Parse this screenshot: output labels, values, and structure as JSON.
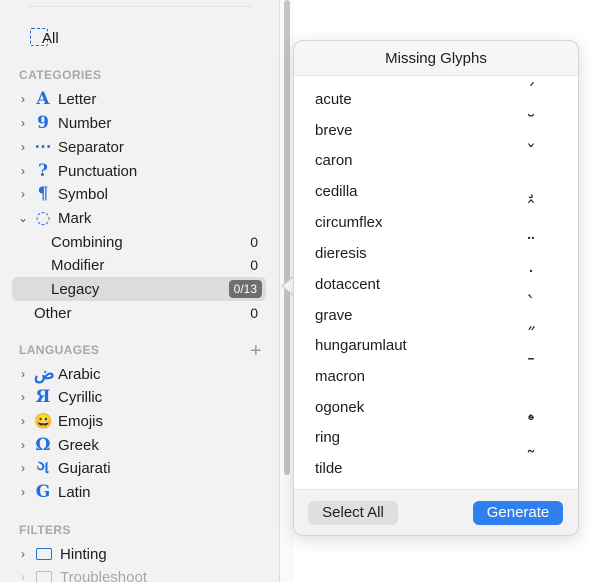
{
  "sidebar": {
    "all_label": "All",
    "categories_header": "CATEGORIES",
    "categories": [
      {
        "icon": "A",
        "label": "Letter"
      },
      {
        "icon": "9",
        "label": "Number"
      },
      {
        "icon": "⋯",
        "label": "Separator"
      },
      {
        "icon": "?",
        "label": "Punctuation"
      },
      {
        "icon": "¶",
        "label": "Symbol"
      },
      {
        "icon": "◌",
        "label": "Mark"
      }
    ],
    "mark_children": [
      {
        "label": "Combining",
        "count": "0"
      },
      {
        "label": "Modifier",
        "count": "0"
      },
      {
        "label": "Legacy",
        "badge": "0/13"
      }
    ],
    "other": {
      "label": "Other",
      "count": "0"
    },
    "languages_header": "LANGUAGES",
    "languages": [
      {
        "icon": "ض",
        "label": "Arabic"
      },
      {
        "icon": "Я",
        "label": "Cyrillic"
      },
      {
        "icon": "😀",
        "label": "Emojis"
      },
      {
        "icon": "Ω",
        "label": "Greek"
      },
      {
        "icon": "ગ",
        "label": "Gujarati"
      },
      {
        "icon": "G",
        "label": "Latin"
      }
    ],
    "filters_header": "FILTERS",
    "filters": [
      {
        "label": "Hinting"
      },
      {
        "label": "Troubleshoot"
      }
    ]
  },
  "popover": {
    "title": "Missing Glyphs",
    "glyphs": [
      {
        "name": "acute",
        "mark": "´"
      },
      {
        "name": "breve",
        "mark": "˘"
      },
      {
        "name": "caron",
        "mark": "ˇ"
      },
      {
        "name": "cedilla",
        "mark": "¸"
      },
      {
        "name": "circumflex",
        "mark": "ˆ"
      },
      {
        "name": "dieresis",
        "mark": "¨"
      },
      {
        "name": "dotaccent",
        "mark": "˙"
      },
      {
        "name": "grave",
        "mark": "`"
      },
      {
        "name": "hungarumlaut",
        "mark": "˝"
      },
      {
        "name": "macron",
        "mark": "¯"
      },
      {
        "name": "ogonek",
        "mark": "˛"
      },
      {
        "name": "ring",
        "mark": "˚"
      },
      {
        "name": "tilde",
        "mark": "˜"
      }
    ],
    "select_all_label": "Select All",
    "generate_label": "Generate"
  },
  "colors": {
    "accent": "#1f6fe0",
    "button_blue": "#2f7ff0"
  }
}
